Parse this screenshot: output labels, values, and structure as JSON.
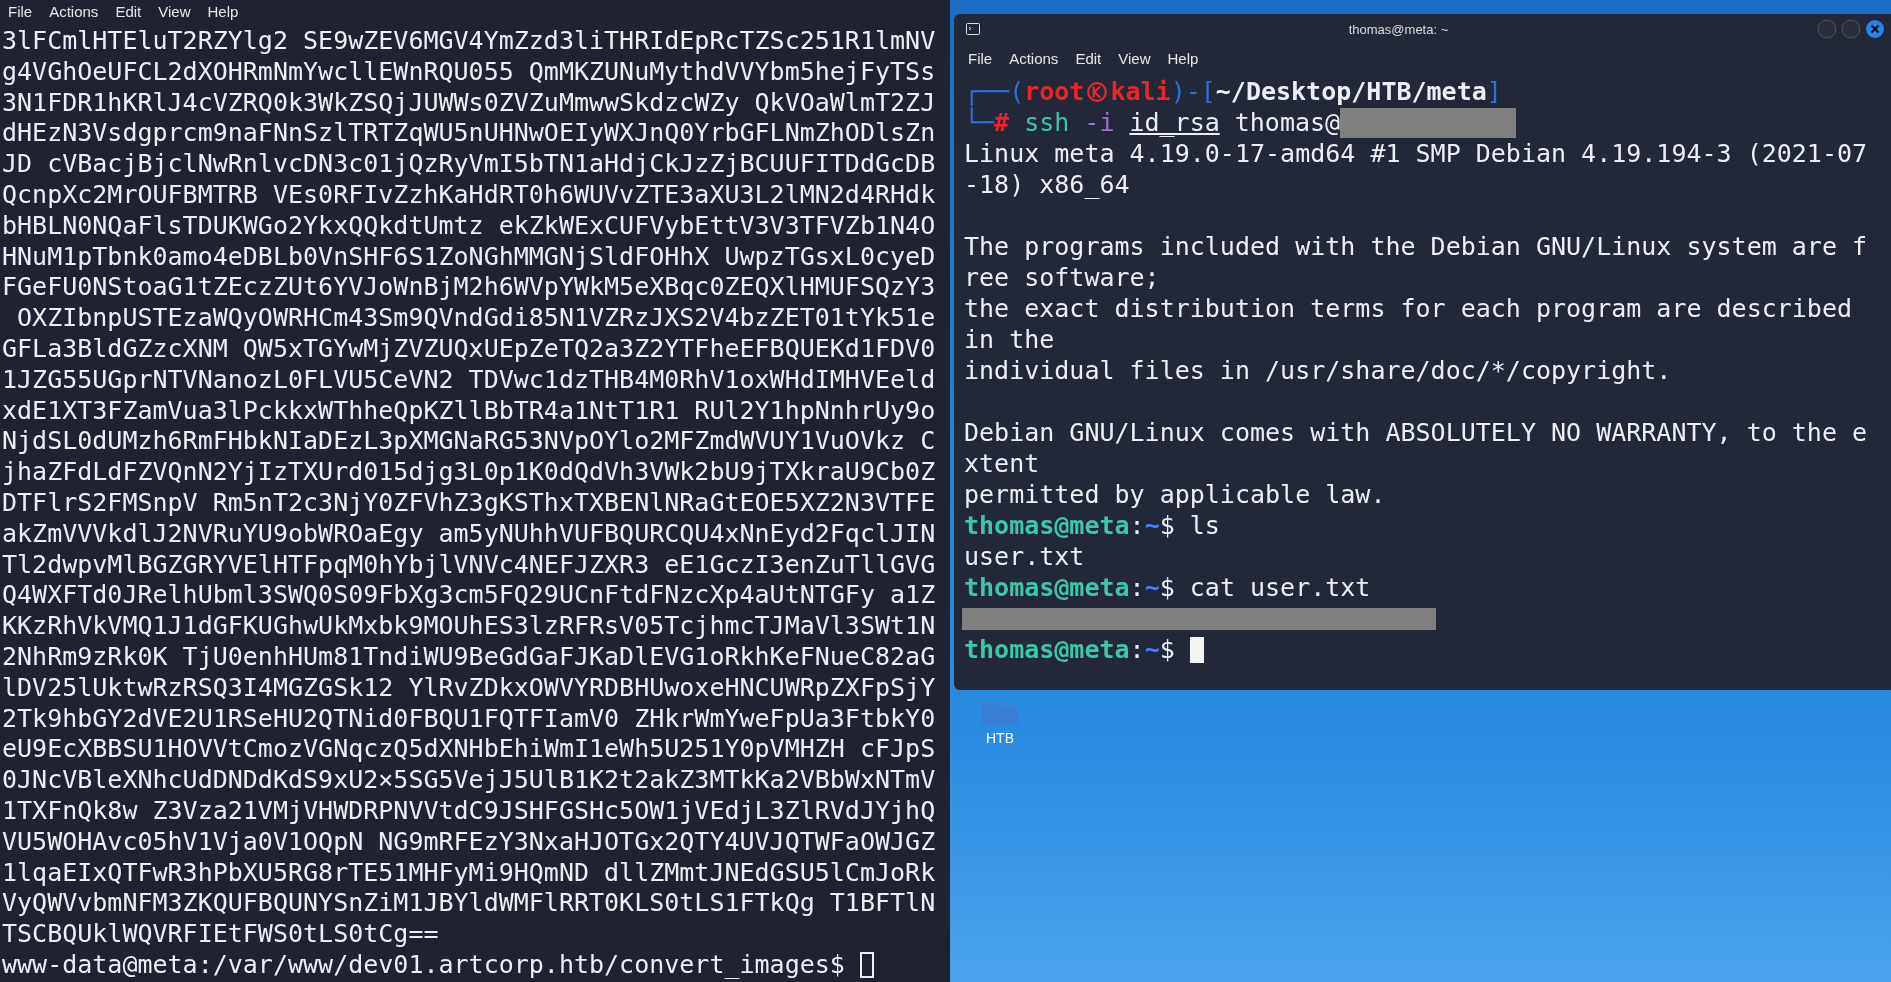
{
  "left_terminal": {
    "menu": [
      "File",
      "Actions",
      "Edit",
      "View",
      "Help"
    ],
    "lines": [
      "3lFCmlHTEluT2RZYlg2 SE9wZEV6MGV4YmZzd3liTHRIdEpRcTZSc251R1lmNV",
      "g4VGhOeUFCL2dXOHRmNmYwcllEWnRQU055 QmMKZUNuMythdVVYbm5hejFyTSs",
      "3N1FDR1hKRlJ4cVZRQ0k3WkZSQjJUWWs0ZVZuMmwwSkdzcWZy QkVOaWlmT2ZJ",
      "dHEzN3Vsdgprcm9naFNnSzlTRTZqWU5nUHNwOEIyWXJnQ0YrbGFLNmZhODlsZn",
      "JD cVBacjBjclNwRnlvcDN3c01jQzRyVmI5bTN1aHdjCkJzZjBCUUFITDdGcDB",
      "QcnpXc2MrOUFBMTRB VEs0RFIvZzhKaHdRT0h6WUVvZTE3aXU3L2lMN2d4RHdk",
      "bHBLN0NQaFlsTDUKWGo2YkxQQkdtUmtz ekZkWExCUFVybEttV3V3TFVZb1N4O",
      "HNuM1pTbnk0amo4eDBLb0VnSHF6S1ZoNGhMMGNjSldFOHhX UwpzTGsxL0cyeD",
      "FGeFU0NStoaG1tZEczZUt6YVJoWnBjM2h6WVpYWkM5eXBqc0ZEQXlHMUFSQzY3",
      " OXZIbnpUSTEzaWQyOWRHCm43Sm9QVndGdi85N1VZRzJXS2V4bzZET01tYk51e",
      "GFLa3BldGZzcXNM QW5xTGYwMjZVZUQxUEpZeTQ2a3Z2YTFheEFBQUEKd1FDV0",
      "1JZG55UGprNTVNanozL0FLVU5CeVN2 TDVwc1dzTHB4M0RhV1oxWHdIMHVEeld",
      "xdE1XT3FZamVua3lPckkxWThheQpKZllBbTR4a1NtT1R1 RUl2Y1hpNnhrUy9o",
      "NjdSL0dUMzh6RmFHbkNIaDEzL3pXMGNaRG53NVpOYlo2MFZmdWVUY1VuOVkz C",
      "jhaZFdLdFZVQnN2YjIzTXUrd015djg3L0p1K0dQdVh3VWk2bU9jTXkraU9Cb0Z",
      "DTFlrS2FMSnpV Rm5nT2c3NjY0ZFVhZ3gKSThxTXBENlNRaGtEOE5XZ2N3VTFE",
      "akZmVVVkdlJ2NVRuYU9obWROaEgy am5yNUhhVUFBQURCQU4xNnEyd2FqclJIN",
      "Tl2dwpvMlBGZGRYVElHTFpqM0hYbjlVNVc4NEFJZXR3 eE1GczI3enZuTllGVG",
      "Q4WXFTd0JRelhUbml3SWQ0S09FbXg3cm5FQ29UCnFtdFNzcXp4aUtNTGFy a1Z",
      "KKzRhVkVMQ1J1dGFKUGhwUkMxbk9MOUhES3lzRFRsV05TcjhmcTJMaVl3SWt1N",
      "2NhRm9zRk0K TjU0enhHUm81TndiWU9BeGdGaFJKaDlEVG1oRkhKeFNueC82aG",
      "lDV25lUktwRzRSQ3I4MGZGSk12 YlRvZDkxOWVYRDBHUwoxeHNCUWRpZXFpSjY",
      "2Tk9hbGY2dVE2U1RSeHU2QTNid0FBQU1FQTFIamV0 ZHkrWmYweFpUa3FtbkY0",
      "eU9EcXBBSU1HOVVtCmozVGNqczQ5dXNHbEhiWmI1eWh5U251Y0pVMHZH cFJpS",
      "0JNcVBleXNhcUdDNDdKdS9xU2×5SG5VejJ5UlB1K2t2akZ3MTkKa2VBbWxNTmV",
      "1TXFnQk8w Z3Vza21VMjVHWDRPNVVtdC9JSHFGSHc5OW1jVEdjL3ZlRVdJYjhQ",
      "VU5WOHAvc05hV1Vja0V1OQpN NG9mRFEzY3NxaHJOTGx2QTY4UVJQTWFaOWJGZ",
      "1lqaEIxQTFwR3hPbXU5RG8rTE51MHFyMi9HQmND dllZMmtJNEdGSU5lCmJoRk",
      "VyQWVvbmNFM3ZKQUFBQUNYSnZiM1JBYldWMFlRRT0KLS0tLS1FTkQg T1BFTlN",
      "TSCBQUklWQVRFIEtFWS0tLS0tCg=="
    ],
    "prompt": "www-data@meta:/var/www/dev01.artcorp.htb/convert_images$",
    "cursor": {
      "kind": "outline"
    }
  },
  "right_terminal": {
    "title": "thomas@meta: ~",
    "menu": [
      "File",
      "Actions",
      "Edit",
      "View",
      "Help"
    ],
    "lines": [
      {
        "kind": "text",
        "segments": [
          {
            "kind": "frame",
            "text": "┌──("
          },
          {
            "kind": "host",
            "text": "root"
          },
          {
            "kind": "kali-symbol"
          },
          {
            "kind": "host",
            "text": "kali"
          },
          {
            "kind": "frame",
            "text": ")-["
          },
          {
            "kind": "cwd",
            "text": "~/Desktop/HTB/meta"
          },
          {
            "kind": "frame",
            "text": "]"
          }
        ]
      },
      {
        "kind": "text",
        "segments": [
          {
            "kind": "frame",
            "text": "└─"
          },
          {
            "kind": "root-sign",
            "text": "#"
          },
          {
            "kind": "command",
            "text": "ssh"
          },
          {
            "kind": "option",
            "text": "-i"
          },
          {
            "kind": "file",
            "text": "id_rsa"
          },
          {
            "kind": "plain",
            "text": "thomas@"
          },
          {
            "kind": "redacted"
          }
        ]
      },
      {
        "kind": "text",
        "segments": [
          {
            "kind": "plain",
            "text": "Linux meta 4.19.0-17-amd64 #1 SMP Debian 4.19.194-3 (2021-07"
          }
        ]
      },
      {
        "kind": "text",
        "segments": [
          {
            "kind": "plain",
            "text": "-18) x86_64"
          }
        ]
      },
      {
        "kind": "blank"
      },
      {
        "kind": "text",
        "segments": [
          {
            "kind": "plain",
            "text": "The programs included with the Debian GNU/Linux system are f"
          }
        ]
      },
      {
        "kind": "text",
        "segments": [
          {
            "kind": "plain",
            "text": "ree software;"
          }
        ]
      },
      {
        "kind": "text",
        "segments": [
          {
            "kind": "plain",
            "text": "the exact distribution terms for each program are described"
          }
        ]
      },
      {
        "kind": "text",
        "segments": [
          {
            "kind": "plain",
            "text": "in the"
          }
        ]
      },
      {
        "kind": "text",
        "segments": [
          {
            "kind": "plain",
            "text": "individual files in /usr/share/doc/*/copyright."
          }
        ]
      },
      {
        "kind": "blank"
      },
      {
        "kind": "text",
        "segments": [
          {
            "kind": "plain",
            "text": "Debian GNU/Linux comes with ABSOLUTELY NO WARRANTY, to the e"
          }
        ]
      },
      {
        "kind": "text",
        "segments": [
          {
            "kind": "plain",
            "text": "xtent"
          }
        ]
      },
      {
        "kind": "text",
        "segments": [
          {
            "kind": "plain",
            "text": "permitted by applicable law."
          }
        ]
      },
      {
        "kind": "text",
        "segments": [
          {
            "kind": "user",
            "text": "thomas@meta"
          },
          {
            "kind": "plain",
            "text": ":"
          },
          {
            "kind": "path",
            "text": "~"
          },
          {
            "kind": "plain",
            "text": "$ ls"
          }
        ]
      },
      {
        "kind": "text",
        "segments": [
          {
            "kind": "plain",
            "text": "user.txt"
          }
        ]
      },
      {
        "kind": "text",
        "segments": [
          {
            "kind": "user",
            "text": "thomas@meta"
          },
          {
            "kind": "plain",
            "text": ":"
          },
          {
            "kind": "path",
            "text": "~"
          },
          {
            "kind": "plain",
            "text": "$ cat user.txt"
          }
        ]
      },
      {
        "kind": "text",
        "segments": [
          {
            "kind": "redacted-wide"
          }
        ]
      },
      {
        "kind": "text",
        "segments": [
          {
            "kind": "user",
            "text": "thomas@meta"
          },
          {
            "kind": "plain",
            "text": ":"
          },
          {
            "kind": "path",
            "text": "~"
          },
          {
            "kind": "plain",
            "text": "$"
          },
          {
            "kind": "cursor"
          }
        ]
      }
    ]
  },
  "desktop": {
    "icon_label": "HTB"
  }
}
